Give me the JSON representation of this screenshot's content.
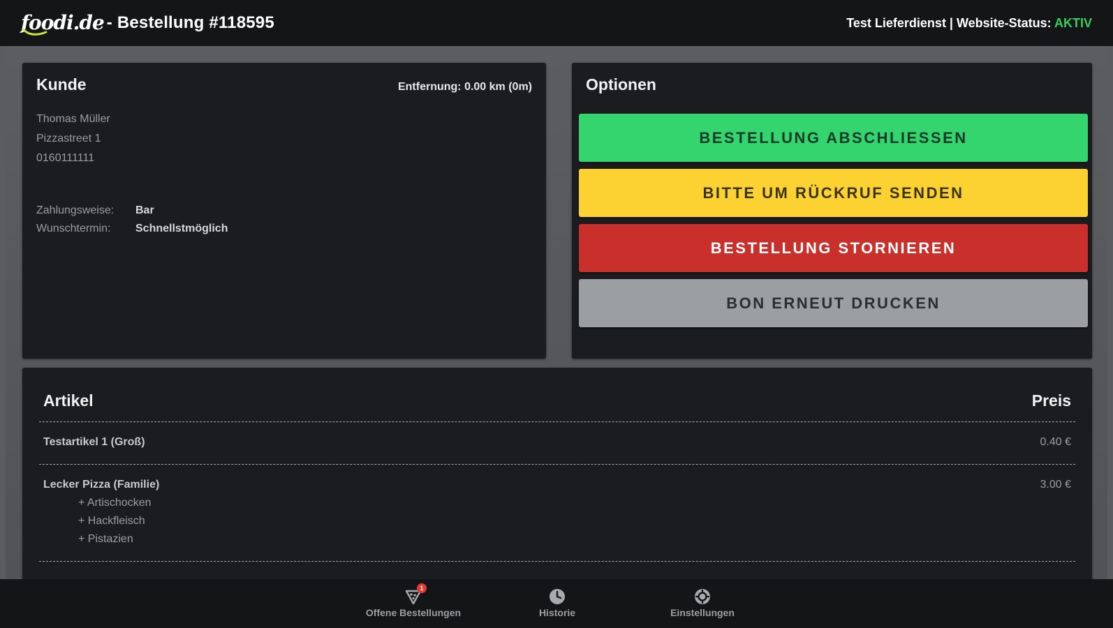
{
  "header": {
    "logo_text": "foodi.de",
    "title": "- Bestellung #118595",
    "status_prefix": "Test Lieferdienst | Website-Status: ",
    "status_value": "AKTIV",
    "status_color": "#35d05a"
  },
  "customer": {
    "title": "Kunde",
    "distance": "Entfernung: 0.00 km (0m)",
    "name": "Thomas Müller",
    "street": "Pizzastreet 1",
    "phone": "0160111111",
    "payment_label": "Zahlungsweise:",
    "payment_value": "Bar",
    "time_label": "Wunschtermin:",
    "time_value": "Schnellstmöglich"
  },
  "options": {
    "title": "Optionen",
    "complete_label": "BESTELLUNG ABSCHLIESSEN",
    "callback_label": "BITTE UM RÜCKRUF SENDEN",
    "cancel_label": "BESTELLUNG STORNIEREN",
    "reprint_label": "BON ERNEUT DRUCKEN",
    "colors": {
      "complete": "#34d46e",
      "callback": "#fcd233",
      "cancel": "#c9302c",
      "reprint": "#9b9ea3"
    }
  },
  "items": {
    "col_article": "Artikel",
    "col_price": "Preis",
    "rows": [
      {
        "name": "Testartikel 1 (Groß)",
        "price": "0.40 €",
        "extras": []
      },
      {
        "name": "Lecker Pizza (Familie)",
        "price": "3.00 €",
        "extras": [
          "+ Artischocken",
          "+ Hackfleisch",
          "+ Pistazien"
        ]
      }
    ]
  },
  "nav": {
    "orders_label": "Offene Bestellungen",
    "orders_badge": "1",
    "history_label": "Historie",
    "settings_label": "Einstellungen"
  }
}
